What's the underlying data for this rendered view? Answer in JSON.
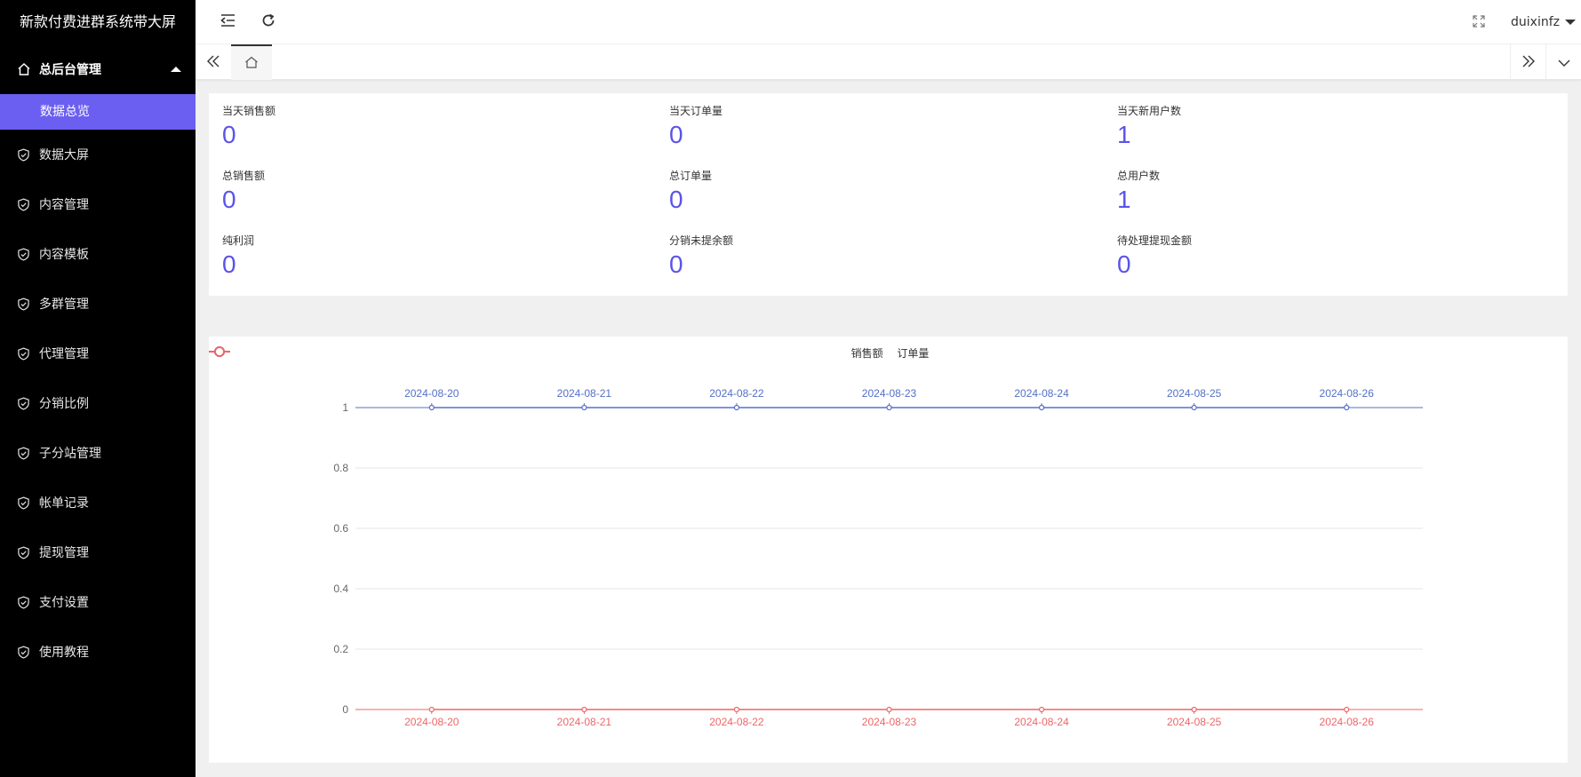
{
  "sidebar": {
    "title": "新款付费进群系统带大屏",
    "parent": {
      "label": "总后台管理",
      "icon": "home-icon",
      "expanded": true
    },
    "active_sub": {
      "label": "数据总览"
    },
    "items": [
      {
        "label": "数据大屏",
        "icon": "shield-check-icon"
      },
      {
        "label": "内容管理",
        "icon": "shield-check-icon"
      },
      {
        "label": "内容模板",
        "icon": "shield-check-icon"
      },
      {
        "label": "多群管理",
        "icon": "shield-check-icon"
      },
      {
        "label": "代理管理",
        "icon": "shield-check-icon"
      },
      {
        "label": "分销比例",
        "icon": "shield-check-icon"
      },
      {
        "label": "子分站管理",
        "icon": "shield-check-icon"
      },
      {
        "label": "帐单记录",
        "icon": "shield-check-icon"
      },
      {
        "label": "提现管理",
        "icon": "shield-check-icon"
      },
      {
        "label": "支付设置",
        "icon": "shield-check-icon"
      },
      {
        "label": "使用教程",
        "icon": "shield-check-icon"
      }
    ]
  },
  "header": {
    "icons": [
      "menu-fold-icon",
      "refresh-icon",
      "fullscreen-icon"
    ],
    "user": "duixinfz"
  },
  "tabs": {
    "icons": [
      "double-chevron-left-icon",
      "home-icon",
      "double-chevron-right-icon",
      "chevron-down-icon"
    ]
  },
  "stats": [
    {
      "label": "当天销售额",
      "value": "0"
    },
    {
      "label": "当天订单量",
      "value": "0"
    },
    {
      "label": "当天新用户数",
      "value": "1"
    },
    {
      "label": "总销售额",
      "value": "0"
    },
    {
      "label": "总订单量",
      "value": "0"
    },
    {
      "label": "总用户数",
      "value": "1"
    },
    {
      "label": "纯利润",
      "value": "0"
    },
    {
      "label": "分销未提余额",
      "value": "0"
    },
    {
      "label": "待处理提现金额",
      "value": "0"
    }
  ],
  "colors": {
    "accent": "#6b5ff1",
    "stat_value": "#5b54e8",
    "series_sales": "#5470c6",
    "series_orders": "#ee6666"
  },
  "chart_data": {
    "type": "line",
    "title": "",
    "x": [
      "2024-08-20",
      "2024-08-21",
      "2024-08-22",
      "2024-08-23",
      "2024-08-24",
      "2024-08-25",
      "2024-08-26"
    ],
    "series": [
      {
        "name": "销售额",
        "values": [
          1,
          1,
          1,
          1,
          1,
          1,
          1
        ],
        "x_axis": "top",
        "color": "#5470c6"
      },
      {
        "name": "订单量",
        "values": [
          0,
          0,
          0,
          0,
          0,
          0,
          0
        ],
        "x_axis": "bottom",
        "color": "#ee6666"
      }
    ],
    "ylim": [
      0,
      1
    ],
    "yticks": [
      "0",
      "0.2",
      "0.4",
      "0.6",
      "0.8",
      "1"
    ],
    "grid": true,
    "legend_position": "top-center"
  }
}
